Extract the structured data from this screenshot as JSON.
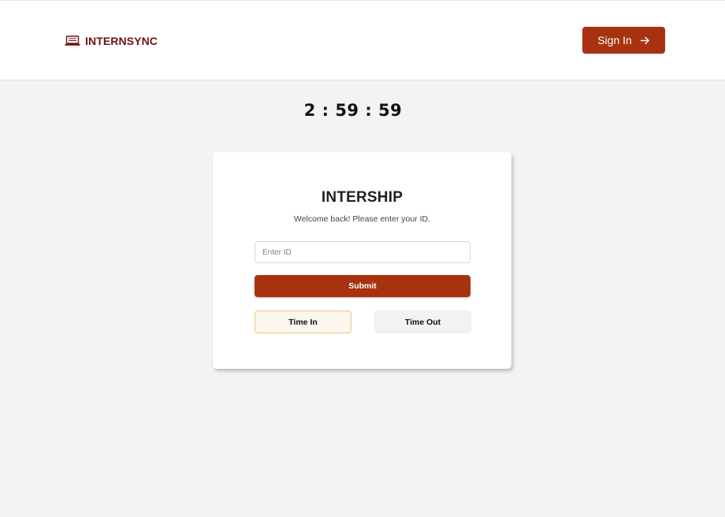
{
  "header": {
    "brand": "INTERNSYNC",
    "logo_icon": "laptop-icon",
    "signin_label": "Sign In",
    "signin_icon": "arrow-right-icon"
  },
  "timer": {
    "display": "2 : 59 : 59"
  },
  "card": {
    "title": "INTERSHIP",
    "subtitle": "Welcome back! Please enter your ID.",
    "id_input": {
      "placeholder": "Enter ID",
      "value": ""
    },
    "submit_label": "Submit",
    "time_in_label": "Time In",
    "time_out_label": "Time Out",
    "selected_mode": "Time In"
  },
  "colors": {
    "accent": "#a8320f",
    "brand_text": "#6b1414",
    "background": "#f2f3f5",
    "selected_border": "#efc67a"
  }
}
